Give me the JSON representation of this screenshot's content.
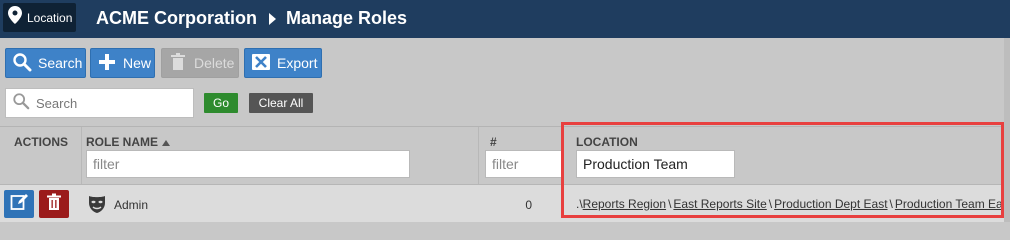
{
  "header": {
    "location_button_label": "Location",
    "org_name": "ACME Corporation",
    "page_title": "Manage Roles"
  },
  "toolbar": {
    "search_label": "Search",
    "new_label": "New",
    "delete_label": "Delete",
    "export_label": "Export",
    "search_placeholder": "Search",
    "go_label": "Go",
    "clear_all_label": "Clear All"
  },
  "grid": {
    "columns": {
      "actions": "ACTIONS",
      "role_name": "ROLE NAME",
      "assigned": "# ASSIGNED",
      "location": "LOCATION"
    },
    "filters": {
      "role_name_placeholder": "filter",
      "assigned_placeholder": "filter",
      "location_value": "Production Team"
    },
    "rows": [
      {
        "role_name": "Admin",
        "assigned": "0",
        "location_prefix": ".\\",
        "location_segments": [
          "Reports Region",
          "East Reports Site",
          "Production Dept East",
          "Production Team East"
        ]
      }
    ]
  },
  "colors": {
    "header_bg": "#1f3d5f",
    "primary_button": "#3e82c8",
    "go_button": "#2e8b2e",
    "delete_row_button": "#9b1b1b",
    "highlight_border": "#e8403f"
  },
  "icons": {
    "location": "map-pin-icon",
    "search": "magnifier-icon",
    "new": "plus-icon",
    "delete": "trash-icon",
    "export": "export-x-icon",
    "edit": "edit-icon",
    "role": "theater-mask-icon"
  }
}
